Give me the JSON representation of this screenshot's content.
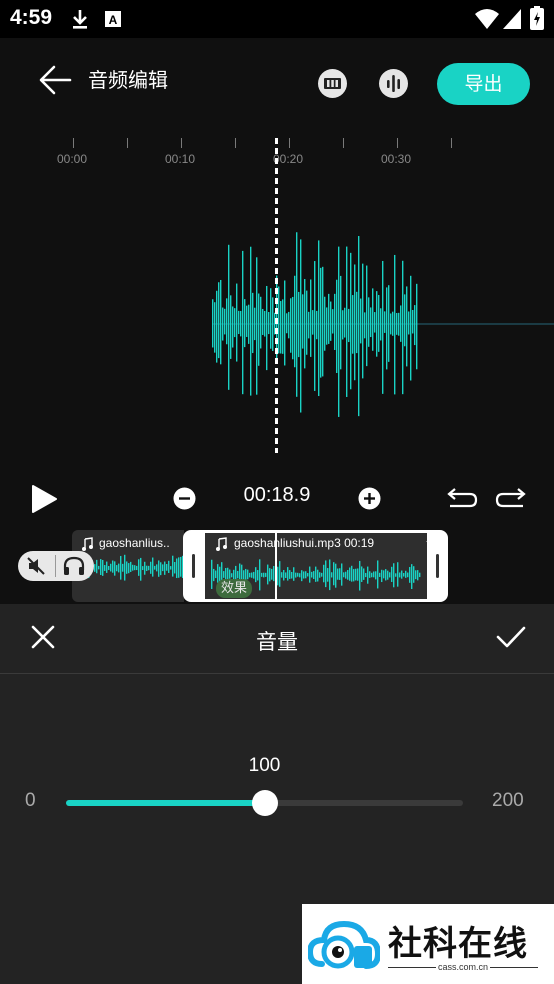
{
  "status_bar": {
    "time": "4:59",
    "icons": [
      "download-icon",
      "font-a-icon",
      "wifi-icon",
      "signal-icon",
      "battery-icon"
    ]
  },
  "header": {
    "title": "音频编辑",
    "back_icon": "arrow-left-icon",
    "tool_icons": [
      "film-strip-icon",
      "equalizer-icon"
    ],
    "export_label": "导出"
  },
  "timeline": {
    "ruler_labels": [
      "00:00",
      "00:10",
      "00:20",
      "00:30"
    ],
    "waveform_color": "#19d3c5"
  },
  "playback": {
    "current_time": "00:18.9",
    "icons": [
      "play-icon",
      "zoom-out-icon",
      "zoom-in-icon",
      "undo-icon",
      "redo-icon"
    ]
  },
  "track": {
    "clips": [
      {
        "name": "gaoshanlius..",
        "music_icon": "music-note-icon"
      },
      {
        "name": "gaoshanliushui.mp3  00:19",
        "music_icon": "music-note-icon",
        "badge": "效果"
      }
    ],
    "trailing_label": "+..",
    "controls": [
      "mute-icon",
      "headphones-icon"
    ]
  },
  "volume_panel": {
    "title": "音量",
    "close_icon": "close-icon",
    "confirm_icon": "check-icon",
    "min_label": "0",
    "max_label": "200",
    "value_label": "100",
    "value": 100,
    "min": 0,
    "max": 200,
    "accent": "#19d3c5"
  },
  "watermark": {
    "brand": "社科在线",
    "domain": "cass.com.cn"
  }
}
